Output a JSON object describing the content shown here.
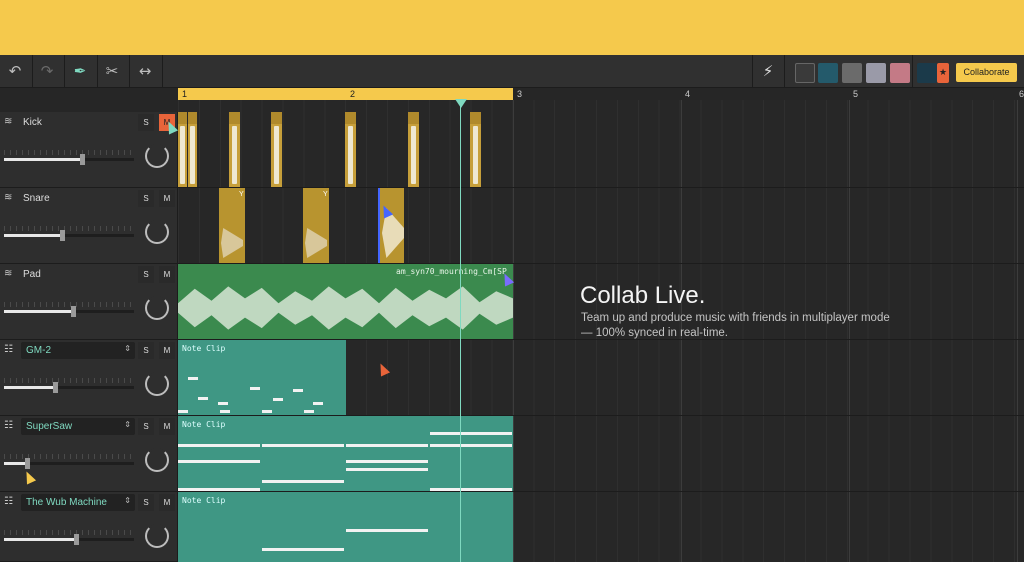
{
  "toolbar": {
    "collaborate_label": "Collaborate",
    "icons": [
      "undo-icon",
      "redo-icon",
      "pen-icon",
      "scissors-icon",
      "resize-icon",
      "lightning-icon"
    ]
  },
  "ruler": {
    "bars": [
      "1",
      "2",
      "3",
      "4",
      "5",
      "6"
    ]
  },
  "tracks": [
    {
      "name": "Kick",
      "type": "drum",
      "solo": "S",
      "mute": "M",
      "volume": 0.6
    },
    {
      "name": "Snare",
      "type": "drum",
      "solo": "S",
      "mute": "M",
      "volume": 0.45
    },
    {
      "name": "Pad",
      "type": "drum",
      "solo": "S",
      "mute": "M",
      "volume": 0.53
    },
    {
      "name": "GM-2",
      "type": "instrument",
      "solo": "S",
      "mute": "M",
      "volume": 0.39
    },
    {
      "name": "SuperSaw",
      "type": "instrument",
      "solo": "S",
      "mute": "M",
      "volume": 0.18
    },
    {
      "name": "The Wub Machine",
      "type": "instrument",
      "solo": "S",
      "mute": "M",
      "volume": 0.55
    }
  ],
  "clips": {
    "pad_label": "am_syn70_mourning_Cm[SP",
    "snare_label": "Y",
    "note_label": "Note Clip"
  },
  "promo": {
    "title": "Collab Live.",
    "subtitle": "Team up and produce music with friends in multiplayer mode — 100% synced in real-time."
  },
  "colors": {
    "accent": "#f5c94c",
    "playhead": "#7fd9c0",
    "note": "#3f9784",
    "pad": "#3b8a4e",
    "kick": "#c69f3a"
  }
}
